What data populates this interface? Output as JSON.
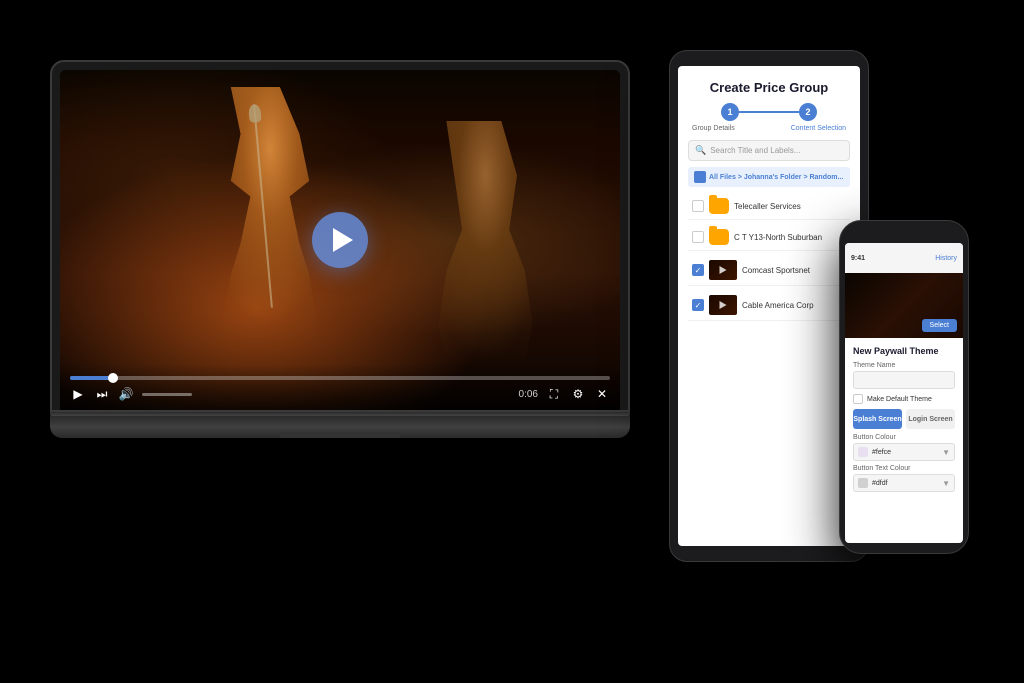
{
  "scene": {
    "background": "#000000"
  },
  "laptop": {
    "video": {
      "play_button_label": "Play",
      "time_current": "0:06",
      "time_total": "0:06",
      "progress_percent": 8
    }
  },
  "tablet": {
    "header": "Create Price Group",
    "stepper": {
      "step1_label": "Group Details",
      "step2_label": "Content Selection",
      "step1_number": "1",
      "step2_number": "2"
    },
    "search": {
      "placeholder": "Search Title and Labels..."
    },
    "breadcrumb": "All Files > Johanna's Folder > Random...",
    "file_items": [
      {
        "name": "Telecaller Services",
        "type": "folder",
        "checked": false
      },
      {
        "name": "C T Y13-North Suburban",
        "type": "folder",
        "checked": false
      },
      {
        "name": "Comcast Sportsnet",
        "type": "video",
        "checked": true
      },
      {
        "name": "Cable America Corp",
        "type": "video",
        "checked": true
      }
    ]
  },
  "phone": {
    "top_bar": {
      "time": "9:41",
      "history_label": "History"
    },
    "video_thumb": {
      "button_label": "Select"
    },
    "form": {
      "title": "New Paywall Theme",
      "theme_name_label": "Theme Name",
      "theme_name_value": "",
      "make_default_label": "Make Default Theme",
      "splash_btn": "Splash Screen",
      "login_btn": "Login Screen",
      "button_colour_label": "Button Colour",
      "button_colour_value": "#fefce",
      "button_text_colour_label": "Button Text Colour",
      "button_text_colour_value": "#dfdf"
    },
    "colors": {
      "button_colour_hex": "#fefce",
      "button_text_colour_hex": "#dfdf",
      "button_colour_swatch": "#e8e0f0",
      "button_text_swatch": "#d0d0d0"
    }
  }
}
